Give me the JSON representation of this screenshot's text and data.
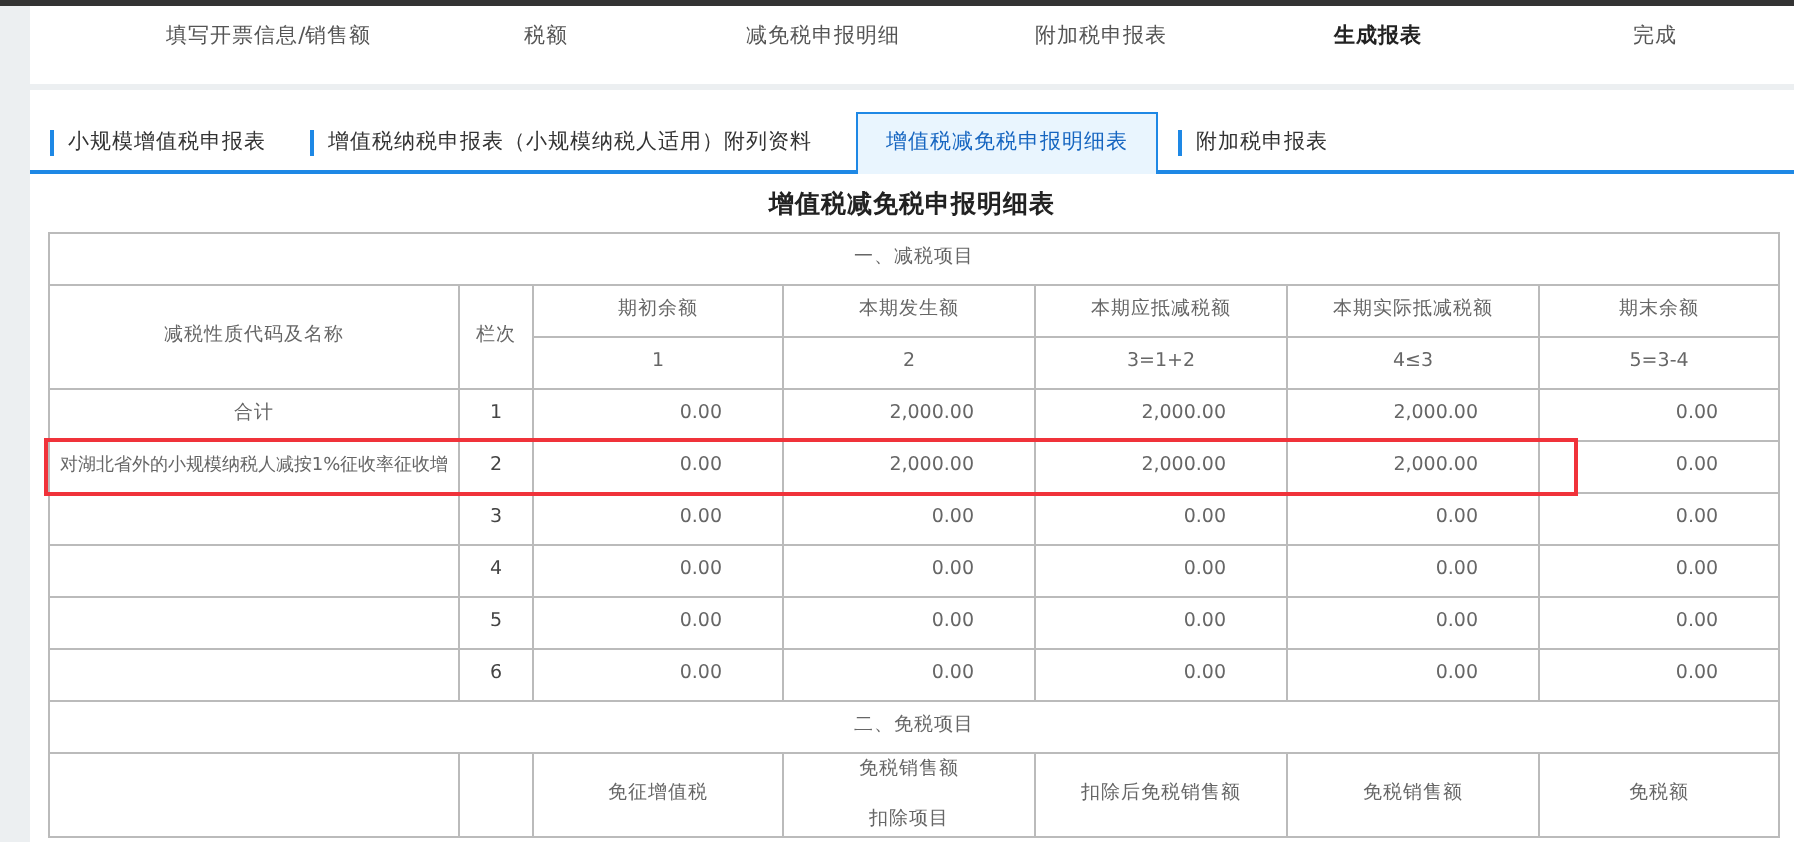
{
  "steps": [
    {
      "label": "填写开票信息/销售额",
      "selected": false
    },
    {
      "label": "税额",
      "selected": false
    },
    {
      "label": "减免税申报明细",
      "selected": false
    },
    {
      "label": "附加税申报表",
      "selected": false
    },
    {
      "label": "生成报表",
      "selected": true
    },
    {
      "label": "完成",
      "selected": false
    }
  ],
  "tabs": [
    {
      "label": "小规模增值税申报表",
      "selected": false
    },
    {
      "label": "增值税纳税申报表（小规模纳税人适用）附列资料",
      "selected": false
    },
    {
      "label": "增值税减免税申报明细表",
      "selected": true
    },
    {
      "label": "附加税申报表",
      "selected": false
    }
  ],
  "form_title": "增值税减免税申报明细表",
  "reduction_section": {
    "title": "一、减税项目",
    "name_column": "减税性质代码及名称",
    "line_column": "栏次",
    "columns": [
      {
        "label": "期初余额",
        "formula": "1"
      },
      {
        "label": "本期发生额",
        "formula": "2"
      },
      {
        "label": "本期应抵减税额",
        "formula": "3=1+2"
      },
      {
        "label": "本期实际抵减税额",
        "formula": "4≤3"
      },
      {
        "label": "期末余额",
        "formula": "5=3-4"
      }
    ],
    "rows": [
      {
        "name": "合计",
        "line": "1",
        "values": [
          "0.00",
          "2,000.00",
          "2,000.00",
          "2,000.00",
          "0.00"
        ],
        "highlighted": false
      },
      {
        "name": "对湖北省外的小规模纳税人减按1%征收率征收增",
        "line": "2",
        "values": [
          "0.00",
          "2,000.00",
          "2,000.00",
          "2,000.00",
          "0.00"
        ],
        "highlighted": true
      },
      {
        "name": "",
        "line": "3",
        "values": [
          "0.00",
          "0.00",
          "0.00",
          "0.00",
          "0.00"
        ],
        "highlighted": false
      },
      {
        "name": "",
        "line": "4",
        "values": [
          "0.00",
          "0.00",
          "0.00",
          "0.00",
          "0.00"
        ],
        "highlighted": false
      },
      {
        "name": "",
        "line": "5",
        "values": [
          "0.00",
          "0.00",
          "0.00",
          "0.00",
          "0.00"
        ],
        "highlighted": false
      },
      {
        "name": "",
        "line": "6",
        "values": [
          "0.00",
          "0.00",
          "0.00",
          "0.00",
          "0.00"
        ],
        "highlighted": false
      }
    ]
  },
  "exemption_section": {
    "title": "二、免税项目",
    "columns": [
      {
        "lines": [
          "免征增值税"
        ]
      },
      {
        "lines": [
          "免税销售额",
          "扣除项目"
        ]
      },
      {
        "lines": [
          "扣除后免税销售额"
        ]
      },
      {
        "lines": [
          "免税销售额"
        ]
      },
      {
        "lines": [
          "免税额"
        ]
      }
    ]
  }
}
